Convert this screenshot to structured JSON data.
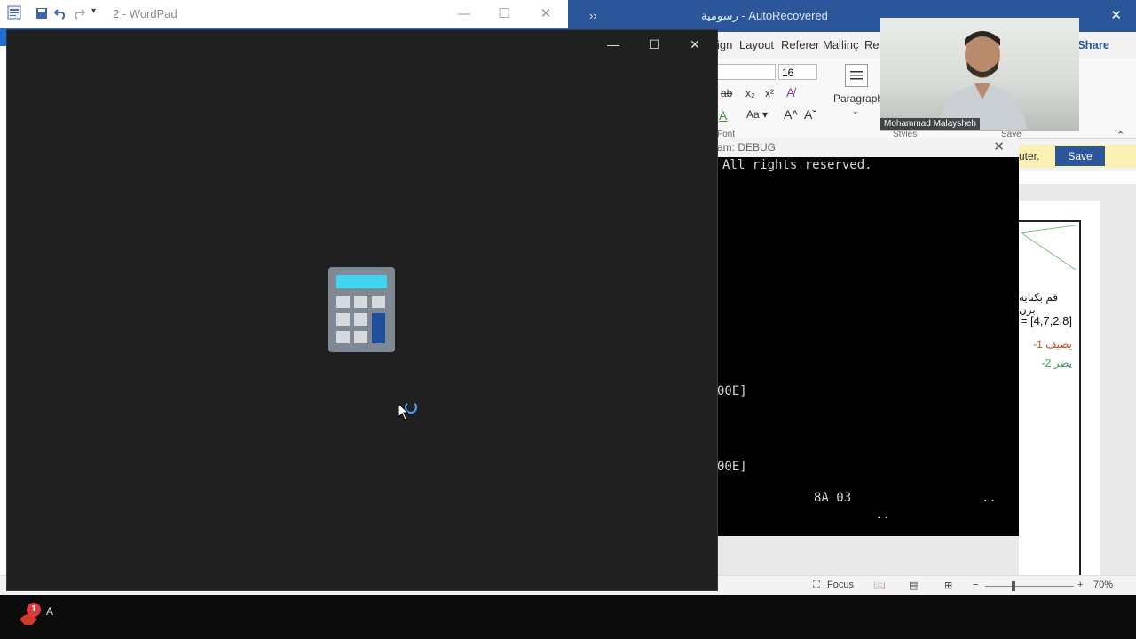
{
  "wordpad": {
    "title": "2 - WordPad"
  },
  "word": {
    "more_label": "››",
    "doc_title": "رسومية - AutoRecovered",
    "tabs": [
      "ign",
      "Layout",
      "Referer",
      "Mailinç",
      "Rev"
    ],
    "share_label": "Share",
    "font_size": "16",
    "paragraph_label": "Paragraph",
    "group_font": "Font",
    "group_styles": "Styles",
    "group_save": "Save",
    "infobar_text": "uter.",
    "save_button": "Save",
    "doc_lines": [
      "قم بكتابة برن",
      "= [4,7,2,8]",
      "-1 يضيف",
      "-2 يضر"
    ],
    "status_focus": "Focus",
    "zoom": "70%",
    "accent": "#2b579a"
  },
  "debug": {
    "title": "am:   DEBUG",
    "line1": "All rights reserved.",
    "line2": "00E]",
    "line3": "00E]",
    "line4": "8A 03",
    "line5": "..",
    "line6": ".."
  },
  "webcam": {
    "name": "Mohammad Malaysheh"
  },
  "calculator": {
    "state": "loading",
    "spinner_color": "#4aa3ff"
  },
  "taskbar": {
    "notification_count": "1",
    "app_label": "A"
  }
}
